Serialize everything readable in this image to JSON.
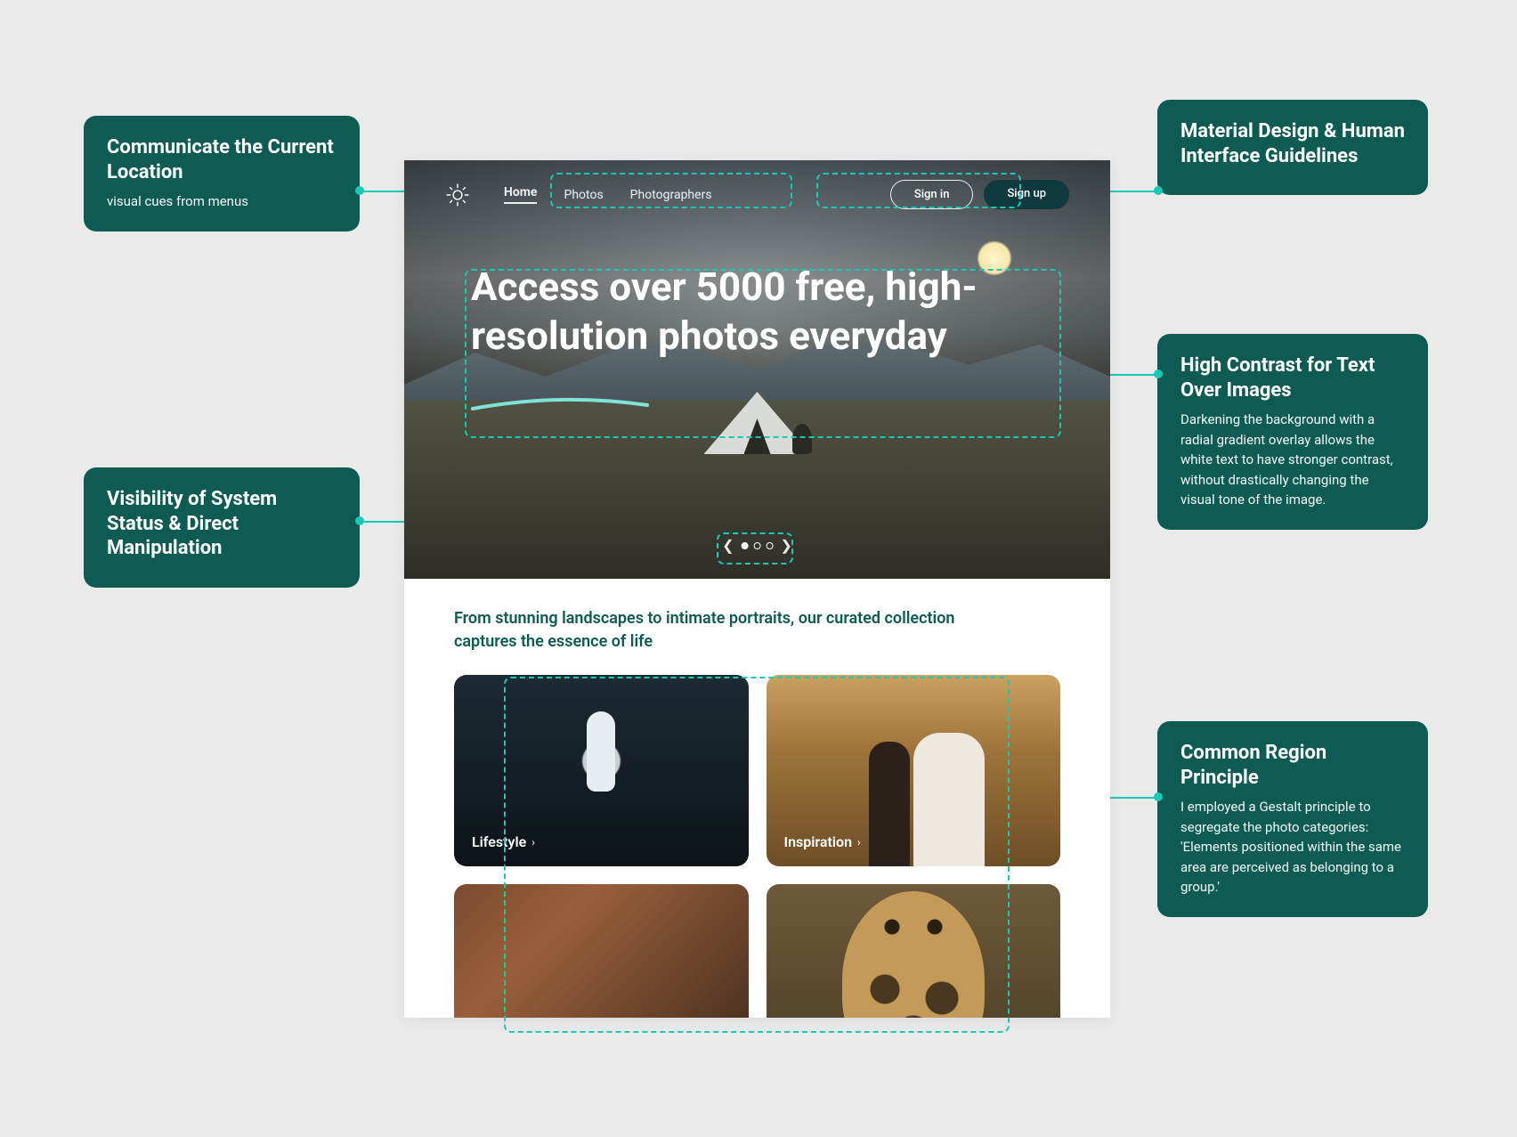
{
  "callouts": {
    "location": {
      "title": "Communicate the Current Location",
      "body": "visual cues from menus"
    },
    "material": {
      "title": "Material Design & Human Interface Guidelines"
    },
    "visibility": {
      "title": "Visibility of System Status & Direct Manipulation"
    },
    "contrast": {
      "title": "High Contrast for Text Over Images",
      "body": "Darkening the background with a radial gradient overlay allows the white text to have stronger contrast, without drastically changing the visual tone of the image."
    },
    "region": {
      "title": "Common Region Principle",
      "body": "I employed a Gestalt principle to segregate the photo categories: 'Elements positioned within the same area are perceived as belonging to a group.'"
    }
  },
  "nav": {
    "home": "Home",
    "photos": "Photos",
    "photographers": "Photographers",
    "signin": "Sign in",
    "signup": "Sign up"
  },
  "hero": {
    "title": "Access over 5000 free, high-resolution photos everyday"
  },
  "section": {
    "title": "From stunning landscapes to intimate portraits, our curated collection captures the essence of life"
  },
  "cards": {
    "lifestyle": "Lifestyle",
    "inspiration": "Inspiration"
  }
}
